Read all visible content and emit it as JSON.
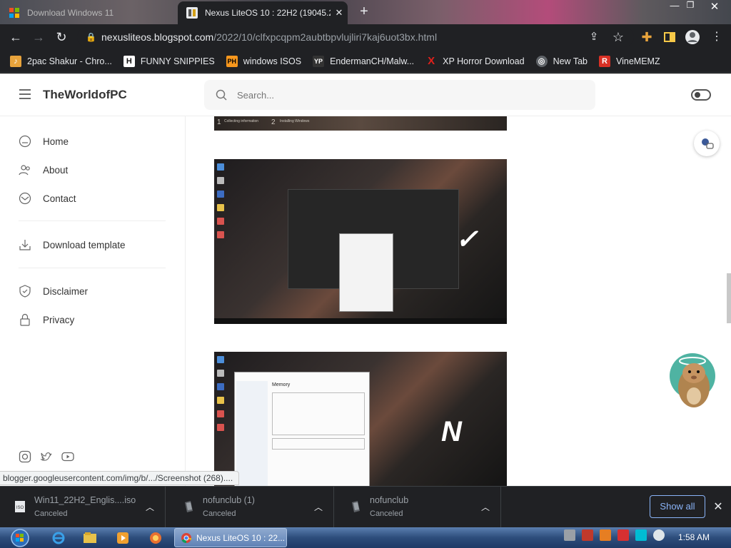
{
  "browser": {
    "tabs": [
      {
        "title": "Download Windows 11",
        "active": false
      },
      {
        "title": "Nexus LiteOS 10 : 22H2 (19045.2",
        "active": true
      }
    ],
    "window_controls": {
      "minimize": "—",
      "maximize": "❐",
      "close": "✕"
    },
    "url_domain": "nexusliteos.blogspot.com",
    "url_path": "/2022/10/clfxpcqpm2aubtbpvlujliri7kaj6uot3bx.html",
    "bookmarks": [
      {
        "label": "2pac Shakur - Chro...",
        "icon": "bookmark-icon",
        "color": "#e8a33c"
      },
      {
        "label": "FUNNY SNIPPIES",
        "icon": "H",
        "color": "#222222"
      },
      {
        "label": "windows ISOS",
        "icon": "PH",
        "color": "#f7971d"
      },
      {
        "label": "EndermanCH/Malw...",
        "icon": "YP",
        "color": "#333333"
      },
      {
        "label": "XP Horror Download",
        "icon": "X",
        "color": "#e0201b"
      },
      {
        "label": "New Tab",
        "icon": "globe-icon",
        "color": "#5f6368"
      },
      {
        "label": "VineMEMZ",
        "icon": "R",
        "color": "#d93025"
      }
    ]
  },
  "site": {
    "title": "TheWorldofPC",
    "search_placeholder": "Search...",
    "sidebar": [
      {
        "label": "Home",
        "icon": "home-icon"
      },
      {
        "label": "About",
        "icon": "people-icon"
      },
      {
        "label": "Contact",
        "icon": "mail-icon"
      },
      {
        "label": "Download template",
        "icon": "download-icon"
      },
      {
        "label": "Disclaimer",
        "icon": "shield-icon"
      },
      {
        "label": "Privacy",
        "icon": "lock-icon"
      }
    ],
    "images": [
      {
        "name": "setup-progress-screenshot",
        "labels": [
          "1",
          "Collecting information",
          "2",
          "Installing Windows"
        ]
      },
      {
        "name": "file-explorer-screenshot",
        "logo": "✓"
      },
      {
        "name": "task-manager-screenshot",
        "logo": "N",
        "title": "Memory"
      }
    ],
    "social": [
      "instagram-icon",
      "twitter-icon",
      "youtube-icon"
    ]
  },
  "status_url": "blogger.googleusercontent.com/img/b/.../Screenshot (268)....",
  "downloads": [
    {
      "name": "Win11_22H2_Englis....iso",
      "status": "Canceled",
      "icon": "iso-icon"
    },
    {
      "name": "nofunclub (1)",
      "status": "Canceled",
      "icon": "file-icon"
    },
    {
      "name": "nofunclub",
      "status": "Canceled",
      "icon": "file-icon"
    }
  ],
  "download_shelf": {
    "show_all": "Show all"
  },
  "taskbar": {
    "active_window": "Nexus LiteOS 10 : 22...",
    "clock": "1:58 AM"
  },
  "colors": {
    "accent": "#8ab4f8",
    "page_bg": "#ffffff",
    "chrome_dark": "#202124"
  }
}
